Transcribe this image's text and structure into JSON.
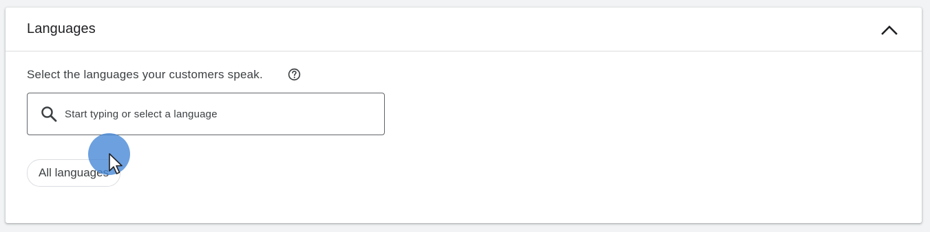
{
  "section": {
    "title": "Languages",
    "collapse_icon": "chevron-up-icon",
    "description": "Select the languages your customers speak.",
    "help_icon": "help-circle-icon"
  },
  "search": {
    "placeholder": "Start typing or select a language",
    "value": "",
    "icon": "search-icon"
  },
  "chips": {
    "all_languages": "All languages"
  },
  "colors": {
    "background": "#f1f3f4",
    "card": "#ffffff",
    "text_primary": "#202124",
    "text_secondary": "#3c4043",
    "border": "#dadce0",
    "cursor_highlight": "#4285d6"
  }
}
